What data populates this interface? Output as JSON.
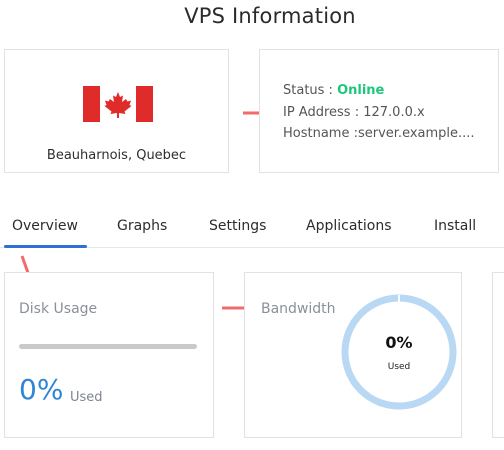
{
  "page": {
    "title": "VPS Information"
  },
  "location": {
    "flag": "canada-flag-icon",
    "label": "Beauharnois, Quebec"
  },
  "status": {
    "status_label": "Status : ",
    "status_value": "Online",
    "ip_line": "IP Address : 127.0.0.x",
    "hostname_line": "Hostname :server.example...."
  },
  "tabs": [
    {
      "label": "Overview",
      "active": true
    },
    {
      "label": "Graphs"
    },
    {
      "label": "Settings"
    },
    {
      "label": "Applications"
    },
    {
      "label": "Install"
    }
  ],
  "disk": {
    "title": "Disk Usage",
    "percent_text": "0%",
    "used_label": "Used",
    "progress_fraction": 0
  },
  "bandwidth": {
    "title": "Bandwidth",
    "percent_text": "0%",
    "used_label": "Used",
    "usage_fraction": 0
  },
  "colors": {
    "accent": "#2f86d6",
    "online": "#1dc77a",
    "arrow": "#f06b6b",
    "donut_ring": "#b9d8f3",
    "tab_underline": "#2f6fd6"
  }
}
